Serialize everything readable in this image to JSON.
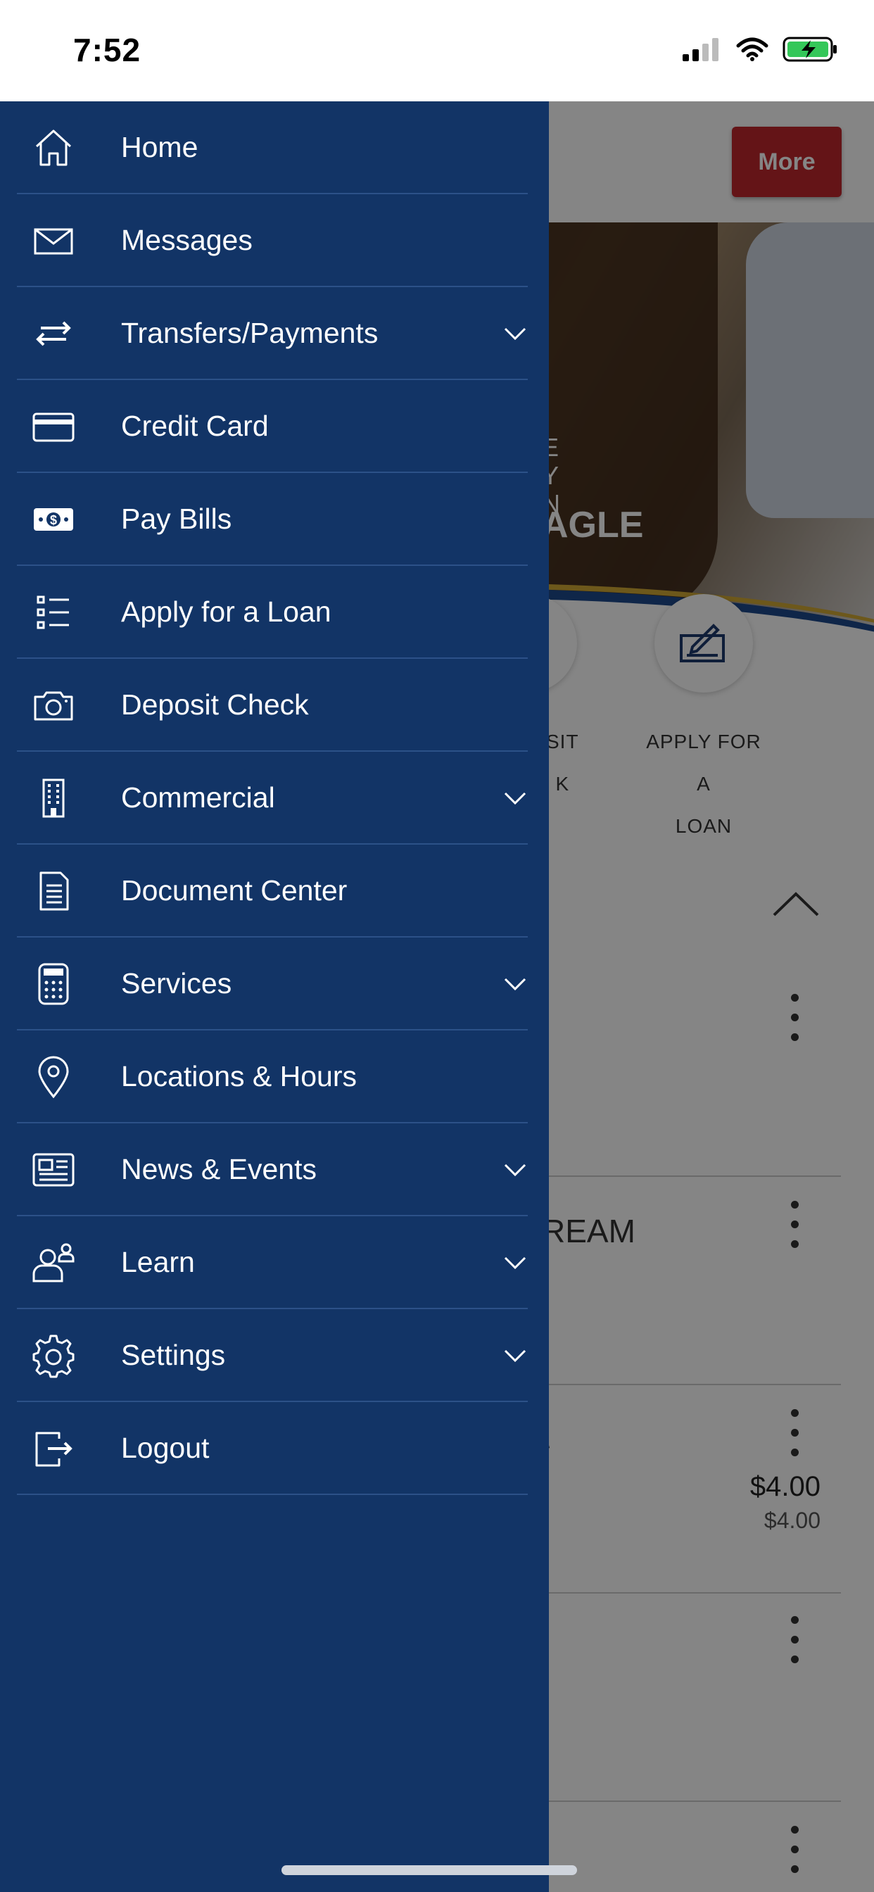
{
  "status_bar": {
    "time": "7:52"
  },
  "background": {
    "more_button": "More",
    "hero_text": "AGLE",
    "hero_logo_lines": [
      "E",
      "Y",
      "N"
    ],
    "quick_actions": {
      "deposit_label_lines": [
        "SIT",
        "K"
      ],
      "apply_label_lines": [
        "APPLY FOR A",
        "LOAN"
      ]
    },
    "account_fragment": "REAM",
    "account_fragment2": "\\",
    "amount_main": "$4.00",
    "amount_sub": "$4.00"
  },
  "menu": {
    "items": [
      {
        "label": "Home",
        "icon": "home-icon",
        "expandable": false
      },
      {
        "label": "Messages",
        "icon": "envelope-icon",
        "expandable": false
      },
      {
        "label": "Transfers/Payments",
        "icon": "transfer-arrows-icon",
        "expandable": true
      },
      {
        "label": "Credit Card",
        "icon": "credit-card-icon",
        "expandable": false
      },
      {
        "label": "Pay Bills",
        "icon": "dollar-bill-icon",
        "expandable": false
      },
      {
        "label": "Apply for a Loan",
        "icon": "checklist-icon",
        "expandable": false
      },
      {
        "label": "Deposit Check",
        "icon": "camera-icon",
        "expandable": false
      },
      {
        "label": "Commercial",
        "icon": "building-icon",
        "expandable": true
      },
      {
        "label": "Document Center",
        "icon": "document-icon",
        "expandable": false
      },
      {
        "label": "Services",
        "icon": "calculator-icon",
        "expandable": true
      },
      {
        "label": "Locations & Hours",
        "icon": "map-pin-icon",
        "expandable": false
      },
      {
        "label": "News & Events",
        "icon": "newspaper-icon",
        "expandable": true
      },
      {
        "label": "Learn",
        "icon": "users-icon",
        "expandable": true
      },
      {
        "label": "Settings",
        "icon": "gear-icon",
        "expandable": true
      },
      {
        "label": "Logout",
        "icon": "logout-icon",
        "expandable": false
      }
    ]
  },
  "colors": {
    "drawer_bg": "#123466",
    "divider": "#2c5188",
    "more_button": "#c0272d",
    "accent_blue": "#1e4a8c",
    "accent_gold": "#d2a934"
  }
}
